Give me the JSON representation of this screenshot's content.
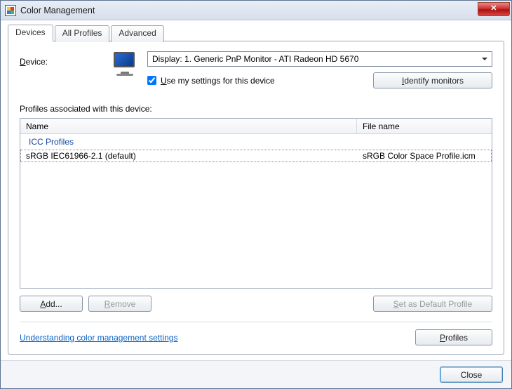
{
  "window": {
    "title": "Color Management"
  },
  "tabs": [
    "Devices",
    "All Profiles",
    "Advanced"
  ],
  "active_tab": 0,
  "device": {
    "label": "Device:",
    "selected": "Display: 1. Generic PnP Monitor - ATI Radeon HD 5670",
    "use_my_settings_label": "Use my settings for this device",
    "use_my_settings_checked": true,
    "identify_button": "Identify monitors"
  },
  "profiles": {
    "section_label": "Profiles associated with this device:",
    "columns": [
      "Name",
      "File name"
    ],
    "group_header": "ICC Profiles",
    "rows": [
      {
        "name": "sRGB IEC61966-2.1 (default)",
        "file": "sRGB Color Space Profile.icm"
      }
    ]
  },
  "buttons": {
    "add": "Add...",
    "remove": "Remove",
    "set_default": "Set as Default Profile",
    "profiles": "Profiles",
    "close": "Close"
  },
  "link": {
    "help": "Understanding color management settings"
  }
}
